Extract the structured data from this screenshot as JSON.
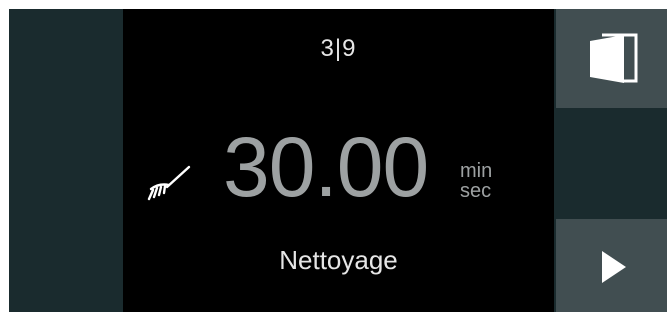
{
  "display": {
    "step": "3|9",
    "time_value": "30.00",
    "time_unit_top": "min",
    "time_unit_bottom": "sec",
    "program_name": "Nettoyage"
  },
  "icons": {
    "left": "cleaning-brush-icon",
    "door": "door-icon",
    "next": "play-triangle-icon"
  },
  "colors": {
    "panel": "#1a2b2e",
    "center_background": "#000000",
    "button": "#414e51",
    "text_primary": "#e6e6e6",
    "text_time": "#9da1a2"
  }
}
